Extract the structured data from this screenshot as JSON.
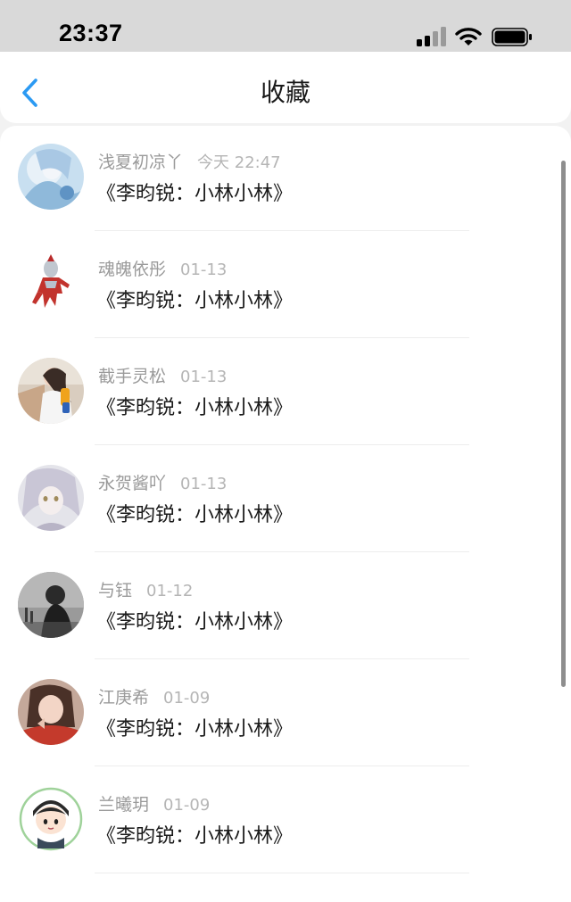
{
  "status_bar": {
    "time": "23:37"
  },
  "header": {
    "title": "收藏",
    "back_icon": "chevron-left-icon",
    "accent_color": "#2b9af3"
  },
  "list": {
    "items": [
      {
        "user": "浅夏初凉丫",
        "time": "今天 22:47",
        "title": "《李昀锐：小林小林》"
      },
      {
        "user": "魂魄依彤",
        "time": "01-13",
        "title": "《李昀锐：小林小林》"
      },
      {
        "user": "截手灵松",
        "time": "01-13",
        "title": "《李昀锐：小林小林》"
      },
      {
        "user": "永贺酱吖",
        "time": "01-13",
        "title": "《李昀锐：小林小林》"
      },
      {
        "user": "与钰",
        "time": "01-12",
        "title": "《李昀锐：小林小林》"
      },
      {
        "user": "江庚希",
        "time": "01-09",
        "title": "《李昀锐：小林小林》"
      },
      {
        "user": "兰曦玥",
        "time": "01-09",
        "title": "《李昀锐：小林小林》"
      }
    ]
  }
}
